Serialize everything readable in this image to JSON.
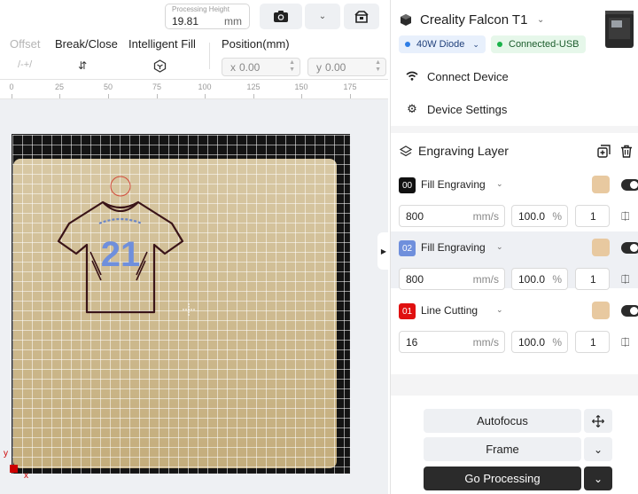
{
  "topbar": {
    "processing_height_label": "Processing Height",
    "processing_height_value": "19.81",
    "processing_height_unit": "mm"
  },
  "toolbar": {
    "offset_label": "Offset",
    "offset_icon_text": "/-+/",
    "break_close_label": "Break/Close",
    "intelligent_fill_label": "Intelligent Fill",
    "position_label": "Position(mm)",
    "x_axis": "x",
    "x_value": "0.00",
    "y_axis": "y",
    "y_value": "0.00"
  },
  "ruler": {
    "ticks": [
      "0",
      "25",
      "50",
      "75",
      "100",
      "125",
      "150",
      "175"
    ]
  },
  "canvas": {
    "shirt_number": "21",
    "y_axis_label": "y",
    "x_axis_label": "x",
    "origin_color": "#c00000"
  },
  "device": {
    "name": "Creality Falcon T1",
    "laser": "40W Diode",
    "status": "Connected-USB",
    "laser_dot_color": "#2f7ee6",
    "status_dot_color": "#19b34a",
    "connect_label": "Connect Device",
    "settings_label": "Device Settings"
  },
  "layers": {
    "title": "Engraving Layer",
    "items": [
      {
        "badge": "00",
        "badge_color": "#111111",
        "name": "Fill Engraving",
        "speed": "800",
        "speed_unit": "mm/s",
        "power": "100.0",
        "power_unit": "%",
        "passes": "1"
      },
      {
        "badge": "02",
        "badge_color": "#6f8fdc",
        "name": "Fill Engraving",
        "speed": "800",
        "speed_unit": "mm/s",
        "power": "100.0",
        "power_unit": "%",
        "passes": "1"
      },
      {
        "badge": "01",
        "badge_color": "#e01010",
        "name": "Line Cutting",
        "speed": "16",
        "speed_unit": "mm/s",
        "power": "100.0",
        "power_unit": "%",
        "passes": "1"
      }
    ]
  },
  "actions": {
    "autofocus": "Autofocus",
    "frame": "Frame",
    "go_processing": "Go Processing"
  }
}
